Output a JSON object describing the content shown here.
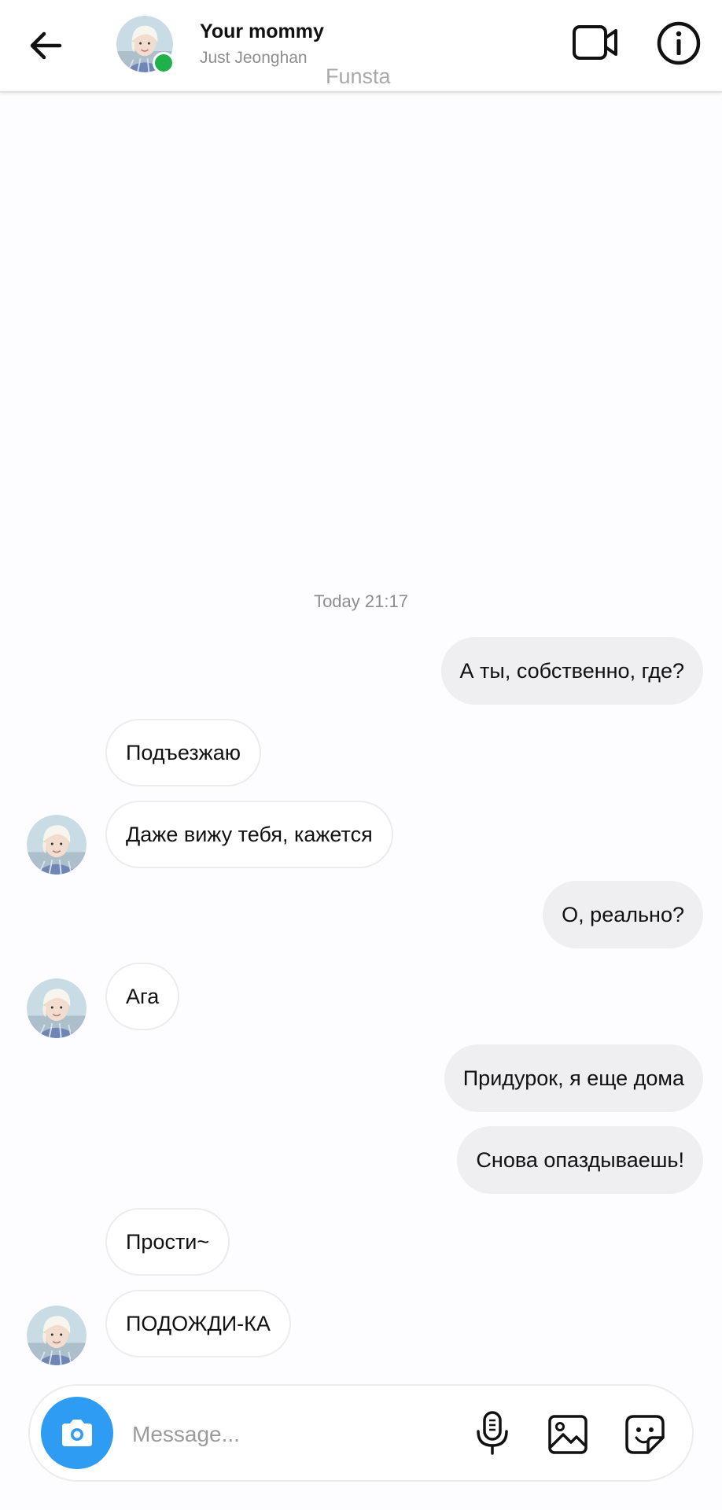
{
  "header": {
    "name": "Your mommy",
    "subtitle": "Just Jeonghan",
    "overlay_label": "Funsta",
    "online_color": "#1fb24a",
    "icons": [
      "back-arrow-icon",
      "video-call-icon",
      "info-icon"
    ]
  },
  "chat": {
    "timestamp": "Today 21:17",
    "messages": [
      {
        "from": "me",
        "text": "А ты, собственно, где?"
      },
      {
        "from": "them",
        "text": "Подъезжаю"
      },
      {
        "from": "them",
        "text": "Даже вижу тебя, кажется"
      },
      {
        "from": "me",
        "text": "О, реально?"
      },
      {
        "from": "them",
        "text": "Ага"
      },
      {
        "from": "me",
        "text": "Придурок, я еще дома"
      },
      {
        "from": "me",
        "text": "Снова опаздываешь!"
      },
      {
        "from": "them",
        "text": "Прости~"
      },
      {
        "from": "them",
        "text": "ПОДОЖДИ-КА"
      }
    ]
  },
  "composer": {
    "placeholder": "Message...",
    "accent_color": "#2f9cf4",
    "icons": [
      "camera-icon",
      "microphone-icon",
      "gallery-icon",
      "sticker-icon"
    ]
  }
}
